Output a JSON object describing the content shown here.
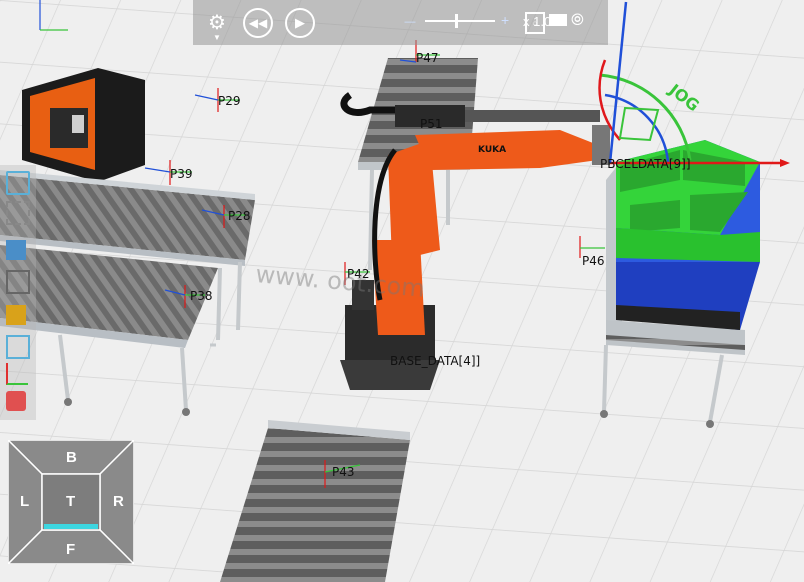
{
  "toolbar": {
    "speed_label": "x 1.0",
    "buttons": [
      "gear-icon",
      "rewind-icon",
      "play-icon",
      "pdf-icon",
      "video-icon",
      "signal-icon"
    ]
  },
  "scene": {
    "watermark": "www.    oot.com",
    "jog_label": "JOG",
    "robot_brand": "KUKA",
    "points": {
      "p47": "P47",
      "p29": "P29",
      "p39": "P39",
      "p28": "P28",
      "p38": "P38",
      "p51": "P51",
      "p42": "P42",
      "p46": "P46",
      "p43": "P43",
      "p_right": "PBCELDATA[9]]",
      "base_data": "BASE_DATA[4]]"
    }
  },
  "view_cube": {
    "top": "B",
    "left": "L",
    "center": "T",
    "right": "R",
    "bottom": "F"
  },
  "colors": {
    "accent_green": "#39c43a",
    "pallet_blue": "#2050d8",
    "robot_orange": "#ee5a1a",
    "view_cube_highlight": "#3dd6e0"
  }
}
